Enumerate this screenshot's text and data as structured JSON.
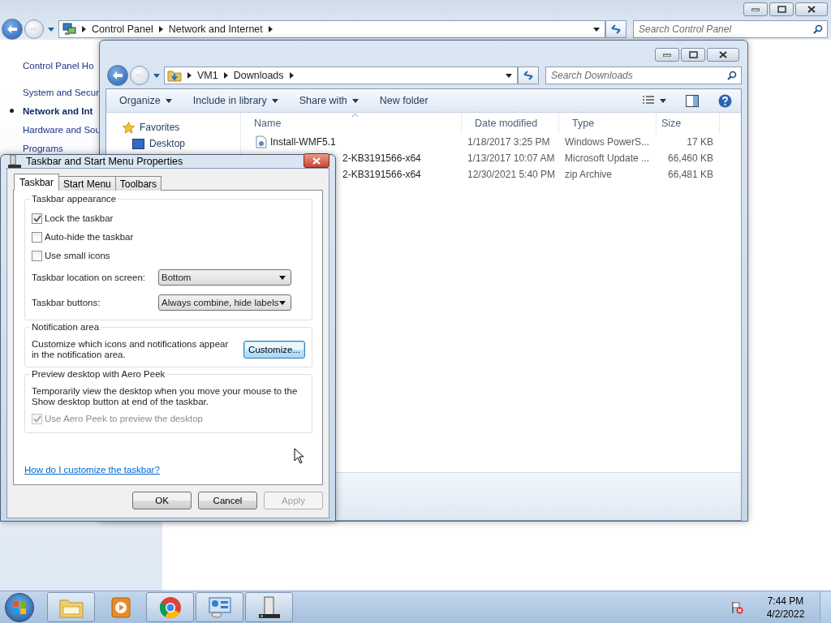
{
  "control_panel": {
    "breadcrumb": [
      "Control Panel",
      "Network and Internet"
    ],
    "search": {
      "placeholder": "Search Control Panel"
    },
    "nav": [
      {
        "label": "Control Panel Ho",
        "selected": false
      },
      {
        "label": "System and Secur",
        "selected": false
      },
      {
        "label": "Network and Int",
        "selected": true
      },
      {
        "label": "Hardware and Sou",
        "selected": false
      },
      {
        "label": "Programs",
        "selected": false
      }
    ]
  },
  "explorer": {
    "breadcrumb": [
      "VM1",
      "Downloads"
    ],
    "search": {
      "placeholder": "Search Downloads"
    },
    "toolbar": [
      {
        "label": "Organize",
        "menu": true
      },
      {
        "label": "Include in library",
        "menu": true
      },
      {
        "label": "Share with",
        "menu": true
      },
      {
        "label": "New folder",
        "menu": false
      }
    ],
    "nav": [
      {
        "label": "Favorites",
        "kind": "group"
      },
      {
        "label": "Desktop",
        "kind": "item"
      }
    ],
    "columns": [
      "Name",
      "Date modified",
      "Type",
      "Size"
    ],
    "rows": [
      {
        "name": "Install-WMF5.1",
        "name_start_hidden": false,
        "date": "1/18/2017 3:25 PM",
        "type": "Windows PowerS...",
        "size": "17 KB"
      },
      {
        "name": "2-KB3191566-x64",
        "name_start_hidden": true,
        "date": "1/13/2017 10:07 AM",
        "type": "Microsoft Update ...",
        "size": "66,460 KB"
      },
      {
        "name": "2-KB3191566-x64",
        "name_start_hidden": true,
        "date": "12/30/2021 5:40 PM",
        "type": "zip Archive",
        "size": "66,481 KB"
      }
    ]
  },
  "dialog": {
    "title": "Taskbar and Start Menu Properties",
    "tabs": [
      {
        "label": "Taskbar",
        "selected": true
      },
      {
        "label": "Start Menu",
        "selected": false
      },
      {
        "label": "Toolbars",
        "selected": false
      }
    ],
    "groups": [
      {
        "title": "Taskbar appearance",
        "items": [
          {
            "kind": "checkbox",
            "label": "Lock the taskbar",
            "checked": true,
            "disabled": false
          },
          {
            "kind": "checkbox",
            "label": "Auto-hide the taskbar",
            "checked": false,
            "disabled": false
          },
          {
            "kind": "checkbox",
            "label": "Use small icons",
            "checked": false,
            "disabled": false
          },
          {
            "kind": "dropdown",
            "label": "Taskbar location on screen:",
            "value": "Bottom"
          },
          {
            "kind": "dropdown",
            "label": "Taskbar buttons:",
            "value": "Always combine, hide labels"
          }
        ]
      },
      {
        "title": "Notification area",
        "items": [
          {
            "kind": "text_button",
            "text": "Customize which icons and notifications appear in the notification area.",
            "button": "Customize...",
            "focused": true
          }
        ]
      },
      {
        "title": "Preview desktop with Aero Peek",
        "items": [
          {
            "kind": "text",
            "text": "Temporarily view the desktop when you move your mouse to the Show desktop button at end of the taskbar."
          },
          {
            "kind": "checkbox",
            "label": "Use Aero Peek to preview the desktop",
            "checked": true,
            "disabled": true
          }
        ]
      }
    ],
    "help_link": "How do I customize the taskbar?",
    "buttons": [
      {
        "label": "OK",
        "disabled": false
      },
      {
        "label": "Cancel",
        "disabled": false
      },
      {
        "label": "Apply",
        "disabled": true
      }
    ]
  },
  "taskbar": {
    "items": [
      {
        "kind": "folder",
        "running": true
      },
      {
        "kind": "media",
        "running": false
      },
      {
        "kind": "browser",
        "running": true
      },
      {
        "kind": "panel",
        "running": true
      },
      {
        "kind": "tower",
        "running": true
      }
    ],
    "clock": {
      "time": "7:44 PM",
      "date": "4/2/2022"
    }
  }
}
